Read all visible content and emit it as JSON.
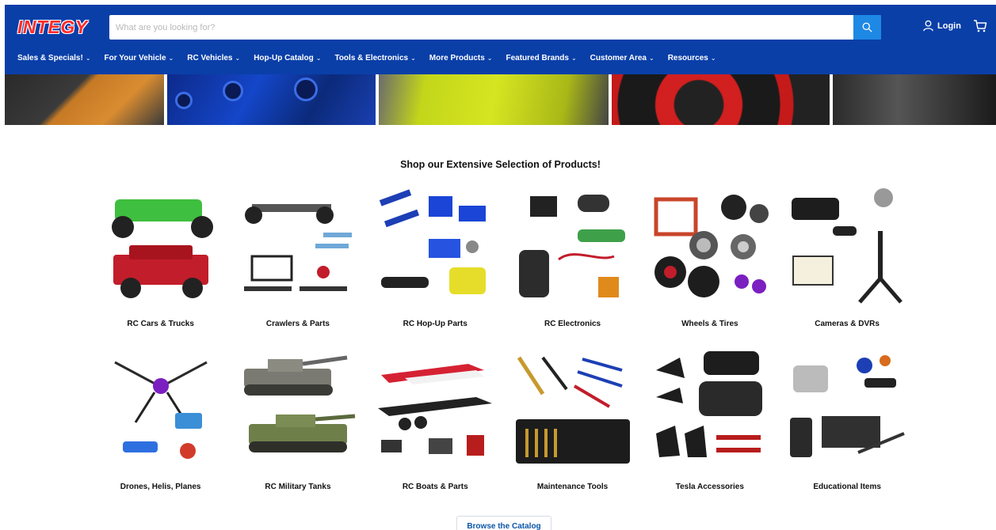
{
  "brand": {
    "logo_text": "INTEGY",
    "logo_color": "#ff2b2b",
    "header_color": "#0a3fa8",
    "accent": "#1e88e5"
  },
  "search": {
    "placeholder": "What are you looking for?",
    "icon": "search-icon"
  },
  "account": {
    "login_label": "Login",
    "icon": "user-icon",
    "cart_icon": "cart-icon"
  },
  "nav": [
    {
      "label": "Sales & Specials!"
    },
    {
      "label": "For Your Vehicle"
    },
    {
      "label": "RC Vehicles"
    },
    {
      "label": "Hop-Up Catalog"
    },
    {
      "label": "Tools & Electronics"
    },
    {
      "label": "More Products"
    },
    {
      "label": "Featured Brands"
    },
    {
      "label": "Customer Area"
    },
    {
      "label": "Resources"
    }
  ],
  "section": {
    "title": "Shop our Extensive Selection of Products!"
  },
  "categories": [
    {
      "label": "RC Cars & Trucks"
    },
    {
      "label": "Crawlers & Parts"
    },
    {
      "label": "RC Hop-Up Parts"
    },
    {
      "label": "RC Electronics"
    },
    {
      "label": "Wheels & Tires"
    },
    {
      "label": "Cameras & DVRs"
    },
    {
      "label": "Drones, Helis, Planes"
    },
    {
      "label": "RC Military Tanks"
    },
    {
      "label": "RC Boats & Parts"
    },
    {
      "label": "Maintenance Tools"
    },
    {
      "label": "Tesla Accessories"
    },
    {
      "label": "Educational Items"
    }
  ],
  "browse": {
    "label": "Browse the Catalog"
  }
}
